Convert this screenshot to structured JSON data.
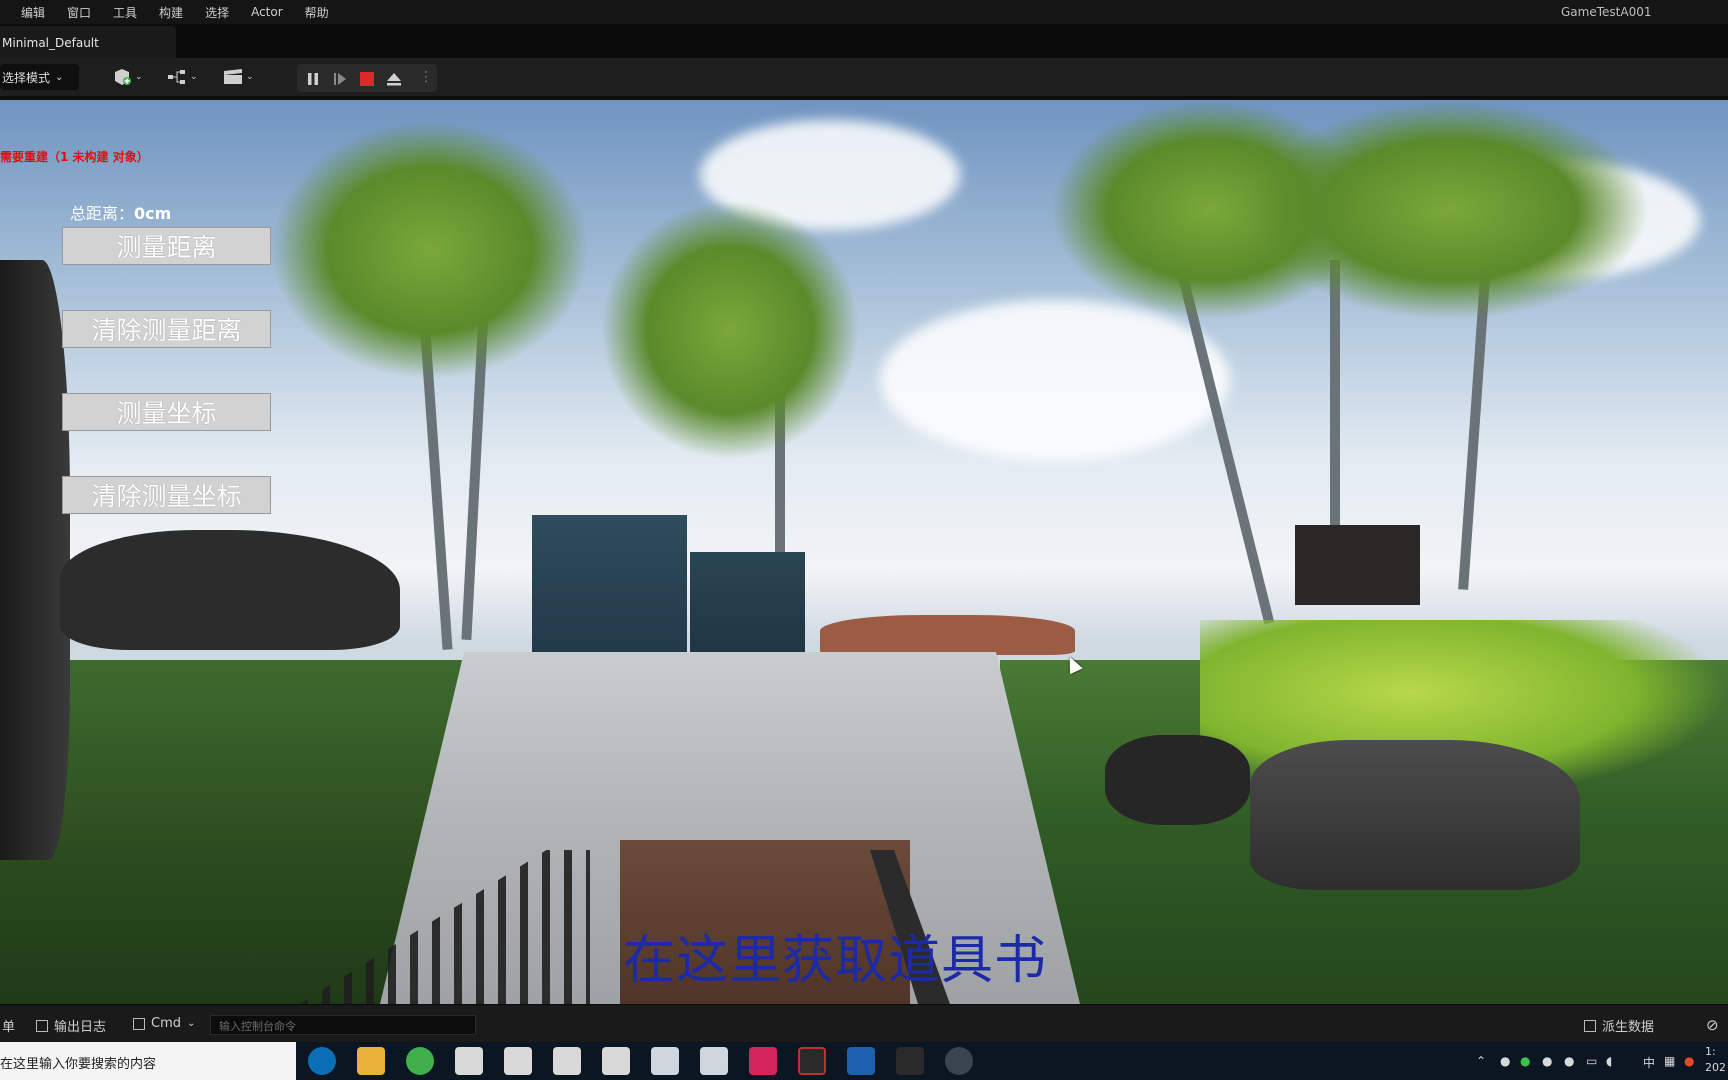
{
  "menu": [
    "编辑",
    "窗口",
    "工具",
    "构建",
    "选择",
    "Actor",
    "帮助"
  ],
  "project_name": "GameTestA001",
  "tab": {
    "title": "Minimal_Default"
  },
  "toolbar": {
    "mode_label": "选择模式"
  },
  "overlay": {
    "warning": "需要重建（1 未构建 对象）",
    "total_label": "总距离：",
    "total_value": "0cm",
    "buttons": [
      "测量距离",
      "清除测量距离",
      "测量坐标",
      "清除测量坐标"
    ],
    "hint_text": "在这里获取道具书"
  },
  "statusbar": {
    "left_cut": "单",
    "output_log": "输出日志",
    "cmd": "Cmd",
    "console_placeholder": "输入控制台命令",
    "derived_data": "派生数据"
  },
  "taskbar": {
    "search_text": "在这里输入你要搜索的内容",
    "ime": "中",
    "clock_time": "1:",
    "clock_date": "202"
  },
  "colors": {
    "warning": "#e01010",
    "hint": "#1d2aa8",
    "stop": "#e0262b"
  }
}
